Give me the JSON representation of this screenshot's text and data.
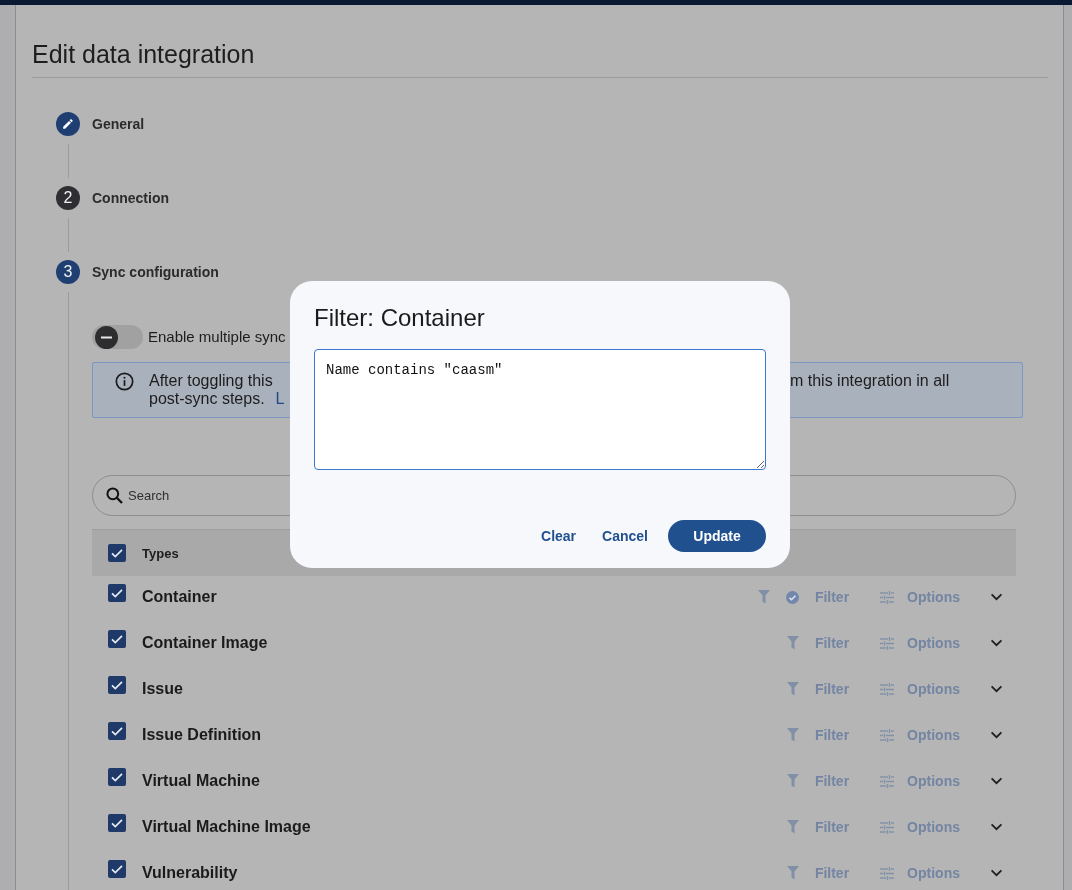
{
  "page": {
    "title": "Edit data integration"
  },
  "steps": [
    {
      "kind": "edit",
      "label": "General",
      "active": true
    },
    {
      "kind": "number",
      "number": "2",
      "label": "Connection",
      "active": false
    },
    {
      "kind": "number",
      "number": "3",
      "label": "Sync configuration",
      "active": true
    }
  ],
  "sync_configuration": {
    "toggle": {
      "label": "Enable multiple sync",
      "on": false
    },
    "info_banner": {
      "line_1_start": "After toggling this",
      "line_1_end": "m this integration in all",
      "line_2_start": "post-sync steps.",
      "link": "L"
    },
    "search": {
      "placeholder": "Search"
    },
    "table": {
      "header": {
        "label": "Types",
        "checked": true
      },
      "rows": [
        {
          "name": "Container",
          "checked": true,
          "filter_applied": true,
          "filter": "Filter",
          "options": "Options",
          "expanded": false
        },
        {
          "name": "Container Image",
          "checked": true,
          "filter_applied": false,
          "filter": "Filter",
          "options": "Options",
          "expanded": false
        },
        {
          "name": "Issue",
          "checked": true,
          "filter_applied": false,
          "filter": "Filter",
          "options": "Options",
          "expanded": false
        },
        {
          "name": "Issue Definition",
          "checked": true,
          "filter_applied": false,
          "filter": "Filter",
          "options": "Options",
          "expanded": false
        },
        {
          "name": "Virtual Machine",
          "checked": true,
          "filter_applied": false,
          "filter": "Filter",
          "options": "Options",
          "expanded": false
        },
        {
          "name": "Virtual Machine Image",
          "checked": true,
          "filter_applied": false,
          "filter": "Filter",
          "options": "Options",
          "expanded": false
        },
        {
          "name": "Vulnerability",
          "checked": true,
          "filter_applied": false,
          "filter": "Filter",
          "options": "Options",
          "expanded": false
        }
      ]
    }
  },
  "dialog": {
    "title": "Filter: Container",
    "value": "Name contains \"caasm\"",
    "buttons": [
      {
        "label": "Clear",
        "kind": "text"
      },
      {
        "label": "Cancel",
        "kind": "text"
      },
      {
        "label": "Update",
        "kind": "primary"
      }
    ]
  }
}
